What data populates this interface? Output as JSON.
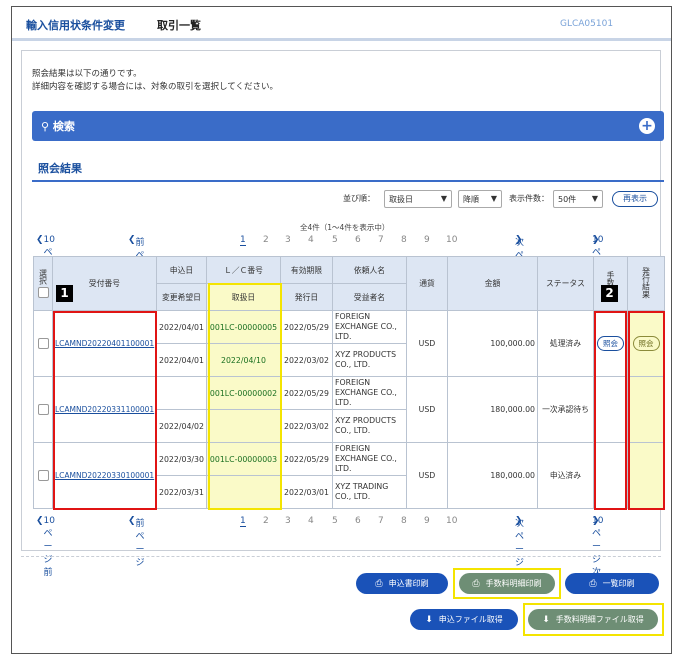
{
  "header": {
    "title": "輸入信用状条件変更",
    "subtitle": "取引一覧",
    "screen_id": "GLCA05101"
  },
  "message": {
    "line1": "照会結果は以下の通りです。",
    "line2": "詳細内容を確認する場合には、対象の取引を選択してください。"
  },
  "search": {
    "label": "検索",
    "expand_icon": "plus-icon"
  },
  "results_title": "照会結果",
  "controls": {
    "sort_label": "並び順：",
    "sort_value": "取扱日",
    "order_value": "降順",
    "count_label": "表示件数：",
    "count_value": "50件",
    "redisplay": "再表示"
  },
  "total_text": "全4件（1〜4件を表示中）",
  "pager": {
    "prev10": "10ページ前",
    "prev": "前ページ",
    "pages": [
      "1",
      "2",
      "3",
      "4",
      "5",
      "6",
      "7",
      "8",
      "9",
      "10"
    ],
    "next": "次ページ",
    "next10": "10ページ次"
  },
  "table": {
    "headers": {
      "select": "選択",
      "ref_no": "受付番号",
      "apply_date": "申込日",
      "lc_no": "Ｌ／Ｃ番号",
      "expiry": "有効期限",
      "applicant": "依頼人名",
      "currency": "通貨",
      "amount": "金額",
      "status": "ステータス",
      "fee": "手数料",
      "issue_result": "発行結果",
      "change_date": "変更希望日",
      "handling_date": "取扱日",
      "issue_date": "発行日",
      "beneficiary": "受益者名"
    },
    "rows": [
      {
        "ref_no": "LCAMND20220401100001",
        "apply_date": "2022/04/01",
        "lc_no": "001LC-00000005",
        "expiry": "2022/05/29",
        "applicant": "FOREIGN EXCHANGE CO., LTD.",
        "currency": "USD",
        "amount": "100,000.00",
        "status": "処理済み",
        "fee_link": "照会",
        "issue_link": "照会",
        "change_date": "2022/04/01",
        "handling_date": "2022/04/10",
        "issue_date": "2022/03/02",
        "beneficiary": "XYZ PRODUCTS CO., LTD."
      },
      {
        "ref_no": "LCAMND20220331100001",
        "apply_date": "",
        "lc_no": "001LC-00000002",
        "expiry": "2022/05/29",
        "applicant": "FOREIGN EXCHANGE CO., LTD.",
        "currency": "USD",
        "amount": "180,000.00",
        "status": "一次承認待ち",
        "change_date": "2022/04/02",
        "handling_date": "",
        "issue_date": "2022/03/02",
        "beneficiary": "XYZ PRODUCTS CO., LTD."
      },
      {
        "ref_no": "LCAMND20220330100001",
        "apply_date": "2022/03/30",
        "lc_no": "001LC-00000003",
        "expiry": "2022/05/29",
        "applicant": "FOREIGN EXCHANGE CO., LTD.",
        "currency": "USD",
        "amount": "180,000.00",
        "status": "申込済み",
        "change_date": "2022/03/31",
        "handling_date": "",
        "issue_date": "2022/03/01",
        "beneficiary": "XYZ TRADING CO., LTD."
      }
    ]
  },
  "badges": {
    "one": "1",
    "two": "2"
  },
  "buttons": {
    "print_application": "申込書印刷",
    "print_fee_detail": "手数料明細印刷",
    "print_list": "一覧印刷",
    "get_application_file": "申込ファイル取得",
    "get_fee_detail_file": "手数料明細ファイル取得"
  }
}
